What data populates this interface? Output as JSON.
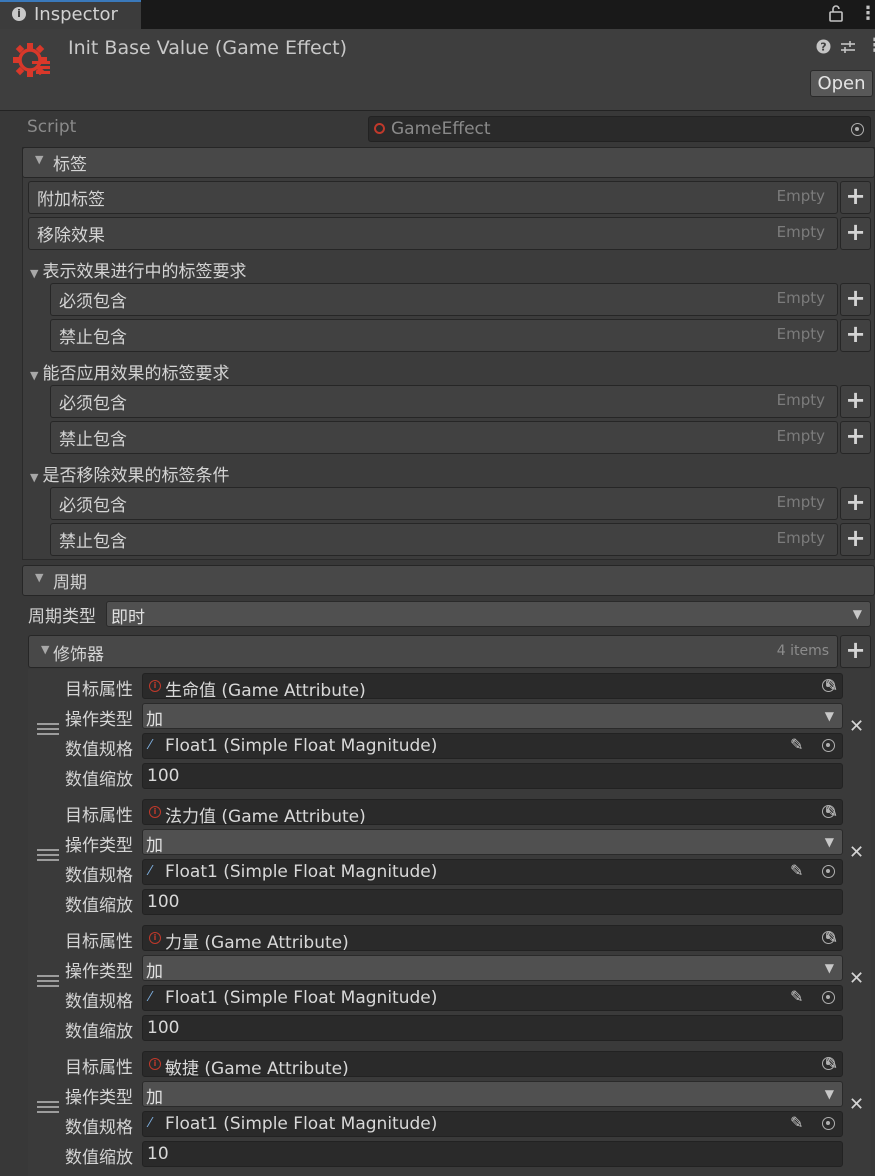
{
  "tab": {
    "label": "Inspector"
  },
  "header": {
    "title": "Init Base Value (Game Effect)",
    "open_label": "Open"
  },
  "script": {
    "label": "Script",
    "value": "GameEffect"
  },
  "tags": {
    "label": "标签",
    "items": [
      {
        "label": "附加标签",
        "value": "Empty"
      },
      {
        "label": "移除效果",
        "value": "Empty"
      }
    ],
    "groups": [
      {
        "label": "表示效果进行中的标签要求",
        "items": [
          {
            "label": "必须包含",
            "value": "Empty"
          },
          {
            "label": "禁止包含",
            "value": "Empty"
          }
        ]
      },
      {
        "label": "能否应用效果的标签要求",
        "items": [
          {
            "label": "必须包含",
            "value": "Empty"
          },
          {
            "label": "禁止包含",
            "value": "Empty"
          }
        ]
      },
      {
        "label": "是否移除效果的标签条件",
        "items": [
          {
            "label": "必须包含",
            "value": "Empty"
          },
          {
            "label": "禁止包含",
            "value": "Empty"
          }
        ]
      }
    ]
  },
  "period": {
    "label": "周期",
    "type_label": "周期类型",
    "type_value": "即时"
  },
  "modifiers": {
    "label": "修饰器",
    "count": "4 items",
    "field_labels": {
      "target": "目标属性",
      "op": "操作类型",
      "magnitude": "数值规格",
      "scale": "数值缩放"
    },
    "items": [
      {
        "target": "生命值 (Game Attribute)",
        "op": "加",
        "magnitude": "Float1 (Simple Float Magnitude)",
        "scale": "100"
      },
      {
        "target": "法力值 (Game Attribute)",
        "op": "加",
        "magnitude": "Float1 (Simple Float Magnitude)",
        "scale": "100"
      },
      {
        "target": "力量 (Game Attribute)",
        "op": "加",
        "magnitude": "Float1 (Simple Float Magnitude)",
        "scale": "100"
      },
      {
        "target": "敏捷 (Game Attribute)",
        "op": "加",
        "magnitude": "Float1 (Simple Float Magnitude)",
        "scale": "10"
      }
    ]
  },
  "colors": {
    "accent_tab": "#3a79bb",
    "effect_icon": "#d9382a",
    "background": "#383838"
  }
}
